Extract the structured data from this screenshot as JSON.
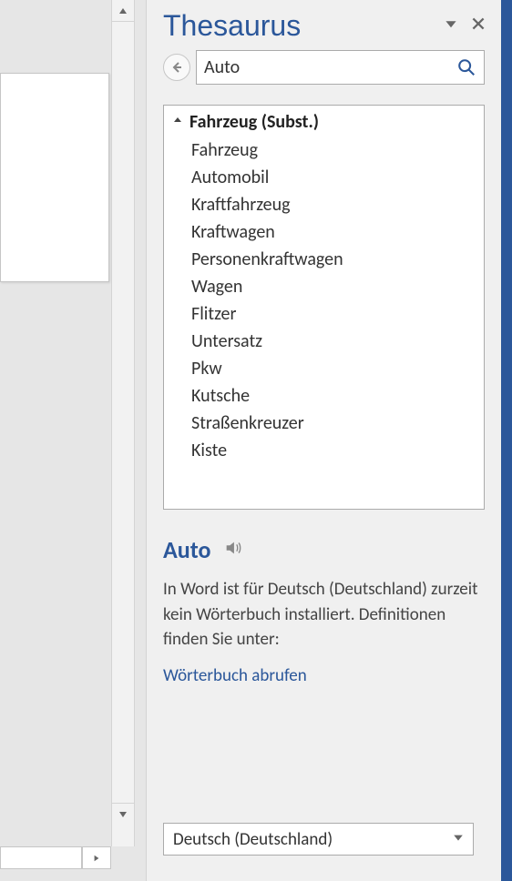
{
  "pane": {
    "title": "Thesaurus",
    "search_value": "Auto",
    "group_header": "Fahrzeug (Subst.)",
    "results": [
      "Fahrzeug",
      "Automobil",
      "Kraftfahrzeug",
      "Kraftwagen",
      "Personenkraftwagen",
      "Wagen",
      "Flitzer",
      "Untersatz",
      "Pkw",
      "Kutsche",
      "Straßenkreuzer",
      "Kiste"
    ]
  },
  "definition": {
    "word": "Auto",
    "text": "In Word ist für Deutsch (Deutschland) zurzeit kein Wörterbuch installiert. Definitionen finden Sie unter:",
    "link": "Wörterbuch abrufen"
  },
  "language": {
    "selected": "Deutsch (Deutschland)"
  }
}
